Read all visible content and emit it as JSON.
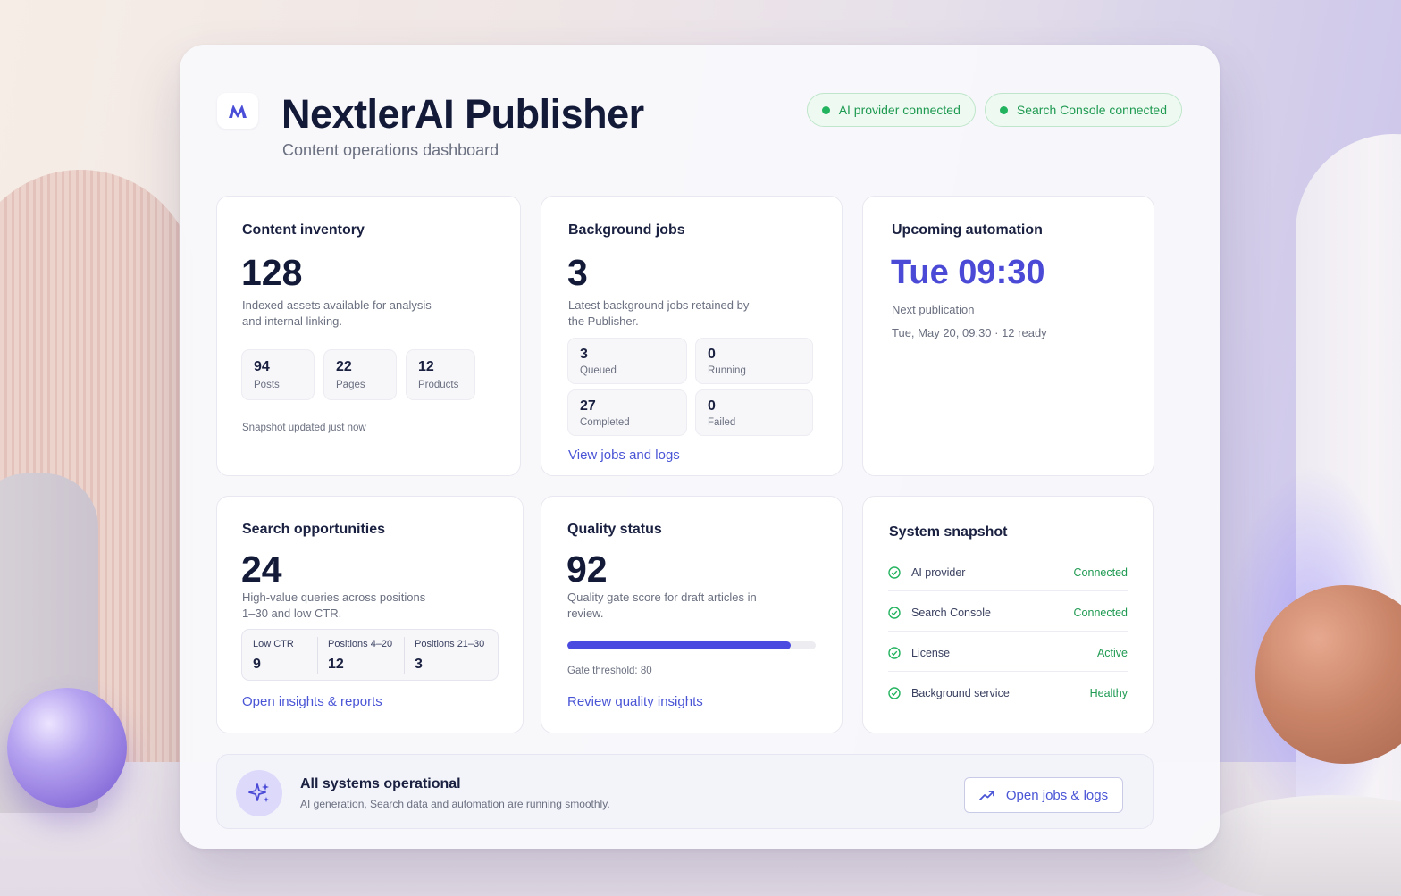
{
  "app": {
    "title": "NextlerAI Publisher",
    "subtitle": "Content operations dashboard",
    "logo_icon": "nextler-logo-icon"
  },
  "status_pills": [
    {
      "label": "AI provider connected",
      "color": "#22b35e"
    },
    {
      "label": "Search Console connected",
      "color": "#22b35e"
    }
  ],
  "content_inventory": {
    "title": "Content inventory",
    "count": "128",
    "description": "Indexed assets available for analysis and internal linking.",
    "stats": [
      {
        "value": "94",
        "label": "Posts"
      },
      {
        "value": "22",
        "label": "Pages"
      },
      {
        "value": "12",
        "label": "Products"
      }
    ],
    "note": "Snapshot updated just now"
  },
  "background_jobs": {
    "title": "Background jobs",
    "count": "3",
    "description": "Latest background jobs retained by the Publisher.",
    "stats": [
      {
        "value": "3",
        "label": "Queued"
      },
      {
        "value": "0",
        "label": "Running"
      },
      {
        "value": "27",
        "label": "Completed"
      },
      {
        "value": "0",
        "label": "Failed"
      }
    ],
    "link": "View jobs and logs"
  },
  "upcoming_automation": {
    "title": "Upcoming automation",
    "time": "Tue 09:30",
    "label": "Next publication",
    "detail": "Tue, May 20, 09:30 · 12 ready",
    "accent": "#4a4ad6"
  },
  "search_opportunities": {
    "title": "Search opportunities",
    "count": "24",
    "description": "High-value queries across positions 1–30 and low CTR.",
    "columns": [
      {
        "label": "Low CTR",
        "value": "9"
      },
      {
        "label": "Positions 4–20",
        "value": "12"
      },
      {
        "label": "Positions 21–30",
        "value": "3"
      }
    ],
    "link": "Open insights & reports"
  },
  "quality_status": {
    "title": "Quality status",
    "score": "92",
    "description": "Quality gate score for draft articles in review.",
    "progress_percent": 90,
    "threshold": "Gate threshold: 80",
    "link": "Review quality insights",
    "bar_color": "#4a4ae0"
  },
  "system_snapshot": {
    "title": "System snapshot",
    "rows": [
      {
        "name": "AI provider",
        "state": "Connected"
      },
      {
        "name": "Search Console",
        "state": "Connected"
      },
      {
        "name": "License",
        "state": "Active"
      },
      {
        "name": "Background service",
        "state": "Healthy"
      }
    ],
    "ok_color": "#1f9a52"
  },
  "footer": {
    "icon": "sparkles-icon",
    "title": "All systems operational",
    "text": "AI generation, Search data and automation are running smoothly.",
    "button_label": "Open jobs & logs",
    "button_icon": "trend-up-icon"
  }
}
